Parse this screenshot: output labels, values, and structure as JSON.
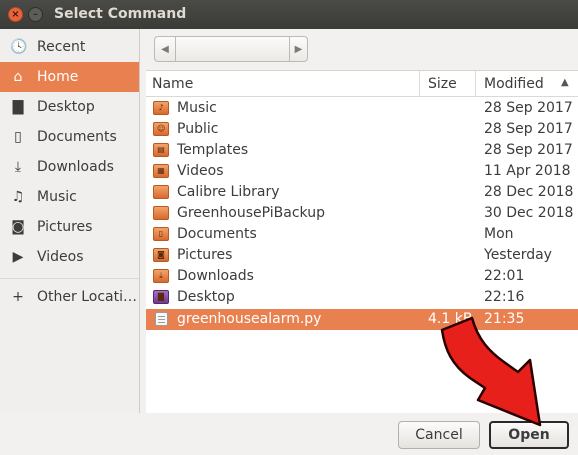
{
  "window": {
    "title": "Select Command",
    "close_glyph": "×",
    "minimize_glyph": "–"
  },
  "sidebar": {
    "items": [
      {
        "label": "Recent",
        "icon": "clock-icon",
        "glyph": "🕓"
      },
      {
        "label": "Home",
        "icon": "home-icon",
        "glyph": "⌂",
        "active": true
      },
      {
        "label": "Desktop",
        "icon": "folder-icon",
        "glyph": "▇"
      },
      {
        "label": "Documents",
        "icon": "document-icon",
        "glyph": "▯"
      },
      {
        "label": "Downloads",
        "icon": "download-icon",
        "glyph": "⤓"
      },
      {
        "label": "Music",
        "icon": "music-icon",
        "glyph": "♫"
      },
      {
        "label": "Pictures",
        "icon": "camera-icon",
        "glyph": "◙"
      },
      {
        "label": "Videos",
        "icon": "video-icon",
        "glyph": "▶"
      },
      {
        "label": "Other Locati…",
        "icon": "plus-icon",
        "glyph": "+"
      }
    ]
  },
  "pathbar": {
    "left_glyph": "◀",
    "right_glyph": "▶"
  },
  "filelist": {
    "columns": {
      "name": "Name",
      "size": "Size",
      "modified": "Modified"
    },
    "sort_glyph": "▲",
    "rows": [
      {
        "name": "Music",
        "size": "",
        "modified": "28 Sep 2017",
        "icon": "music-folder-icon",
        "glyph": "♪"
      },
      {
        "name": "Public",
        "size": "",
        "modified": "28 Sep 2017",
        "icon": "public-folder-icon",
        "glyph": "☺"
      },
      {
        "name": "Templates",
        "size": "",
        "modified": "28 Sep 2017",
        "icon": "templates-folder-icon",
        "glyph": "▤"
      },
      {
        "name": "Videos",
        "size": "",
        "modified": "11 Apr 2018",
        "icon": "videos-folder-icon",
        "glyph": "▦"
      },
      {
        "name": "Calibre Library",
        "size": "",
        "modified": "28 Dec 2018",
        "icon": "folder-icon",
        "glyph": ""
      },
      {
        "name": "GreenhousePiBackup",
        "size": "",
        "modified": "30 Dec 2018",
        "icon": "folder-icon",
        "glyph": ""
      },
      {
        "name": "Documents",
        "size": "",
        "modified": "Mon",
        "icon": "documents-folder-icon",
        "glyph": "▯"
      },
      {
        "name": "Pictures",
        "size": "",
        "modified": "Yesterday",
        "icon": "pictures-folder-icon",
        "glyph": "◙"
      },
      {
        "name": "Downloads",
        "size": "",
        "modified": "22:01",
        "icon": "downloads-folder-icon",
        "glyph": "⤓"
      },
      {
        "name": "Desktop",
        "size": "",
        "modified": "22:16",
        "icon": "desktop-folder-icon",
        "glyph": "▇"
      },
      {
        "name": "greenhousealarm.py",
        "size": "4.1 kB",
        "modified": "21:35",
        "icon": "text-file-icon",
        "glyph": "",
        "selected": true
      }
    ]
  },
  "buttons": {
    "cancel": "Cancel",
    "open": "Open"
  },
  "colors": {
    "accent": "#e9804f",
    "annotation_arrow": "#e8201c"
  }
}
